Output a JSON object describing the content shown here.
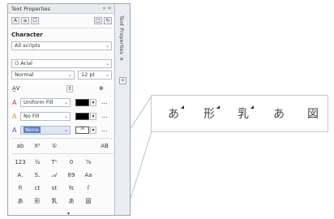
{
  "window": {
    "title": "Text Properties",
    "controls": "»  ×",
    "vertical_tab": "Text Properties  ✕"
  },
  "toolbar": {
    "buttons": [
      "A",
      "≡",
      "☐",
      "□",
      "↻"
    ]
  },
  "character": {
    "section_label": "Character",
    "scripts_value": "All scripts",
    "font_value": "Arial",
    "style_value": "Normal",
    "size_value": "12 pt",
    "kerning_symbol": "A̲V",
    "fill_type_value": "Uniform Fill",
    "background_fill_value": "No Fill",
    "outline_value": "None",
    "more": "..."
  },
  "feature_rows": [
    [
      "ab",
      "X²",
      "①",
      "",
      "",
      "AB"
    ],
    [
      "123",
      "½",
      "Tⁿ",
      "0",
      "⅝",
      ""
    ],
    [
      "A.",
      "S.",
      "𝒜",
      "89",
      "Aa",
      ""
    ],
    [
      "fi",
      "ct",
      "st",
      "fs",
      "ſ",
      ""
    ],
    [
      "あ",
      "形",
      "乳",
      "あ",
      "図",
      ""
    ]
  ],
  "expand_symbol": "▾",
  "callout_glyphs": [
    "あ",
    "形",
    "乳",
    "あ",
    "図"
  ],
  "icons": {
    "font_icon": "O",
    "fill_icon": "A",
    "bg_fill_icon": "A",
    "outline_icon": "A"
  },
  "colors": {
    "accent_fill": "#c0392b",
    "accent_bg": "#e0a020",
    "accent_outline": "#3a5ea8"
  }
}
